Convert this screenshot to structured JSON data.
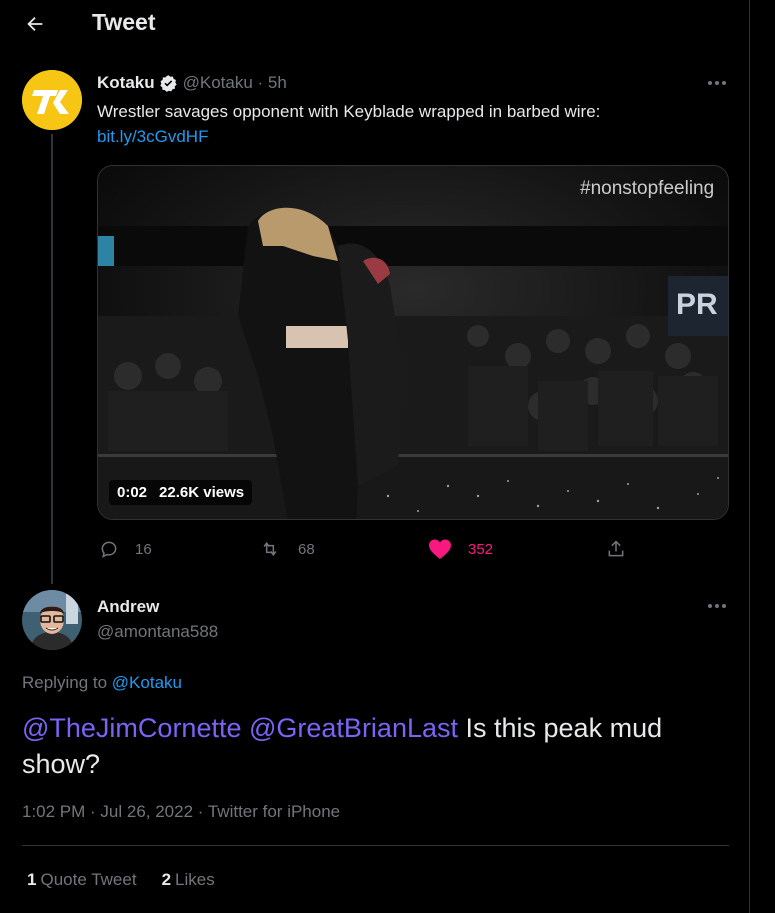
{
  "header": {
    "title": "Tweet",
    "back_icon": "arrow-left-icon"
  },
  "tweet": {
    "author_name": "Kotaku",
    "handle_time": "@Kotaku · 5h",
    "text": "Wrestler savages opponent with Keyblade wrapped in barbed wire:",
    "link": "bit.ly/3cGvdHF",
    "video": {
      "overlay_tag": "#nonstopfeeling",
      "duration": "0:02",
      "views": "22.6K views"
    },
    "actions": {
      "replies": "16",
      "retweets": "68",
      "likes": "352"
    }
  },
  "reply": {
    "author_name": "Andrew",
    "handle": "@amontana588",
    "replying_prefix": "Replying to",
    "replying_to": "@Kotaku",
    "mention_1": "@TheJimCornette",
    "mention_2": "@GreatBrianLast",
    "text": " Is this peak mud show?",
    "meta": "1:02 PM · Jul 26, 2022 · Twitter for iPhone",
    "quote_count": "1",
    "quote_label": "Quote Tweet",
    "likes_count": "2",
    "likes_label": "Likes"
  },
  "colors": {
    "link": "#1d9bf0",
    "like": "#f91880",
    "mention": "#7a63f5",
    "background": "#000000",
    "kotaku_brand": "#f7c614"
  }
}
